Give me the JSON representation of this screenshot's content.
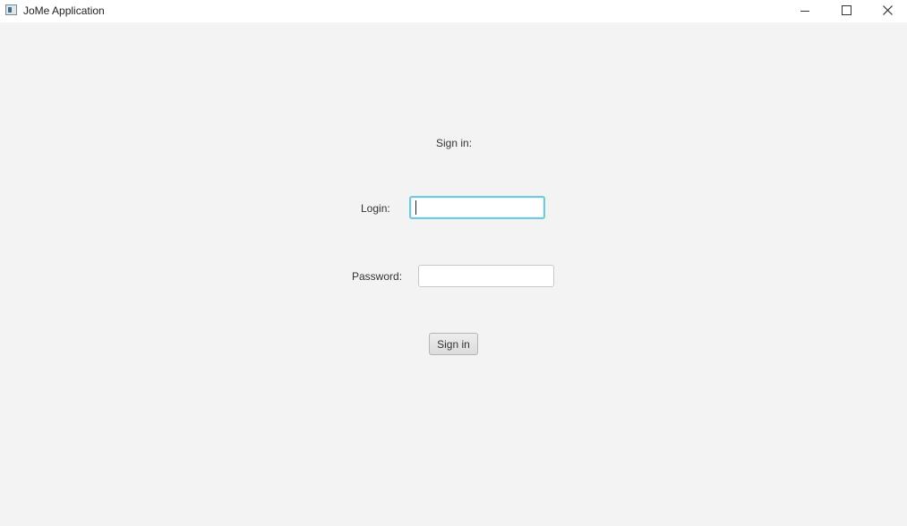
{
  "window": {
    "title": "JoMe Application",
    "controls": {
      "minimize": "minimize",
      "maximize": "maximize",
      "close": "close"
    }
  },
  "form": {
    "heading": "Sign in:",
    "login_label": "Login:",
    "login_value": "",
    "password_label": "Password:",
    "password_value": "",
    "submit_label": "Sign in"
  },
  "colors": {
    "background": "#f3f3f3",
    "focus_border": "#72c9de"
  },
  "icons": {
    "app": "app-window-icon",
    "minimize": "minimize-icon",
    "maximize": "maximize-icon",
    "close": "close-icon"
  }
}
